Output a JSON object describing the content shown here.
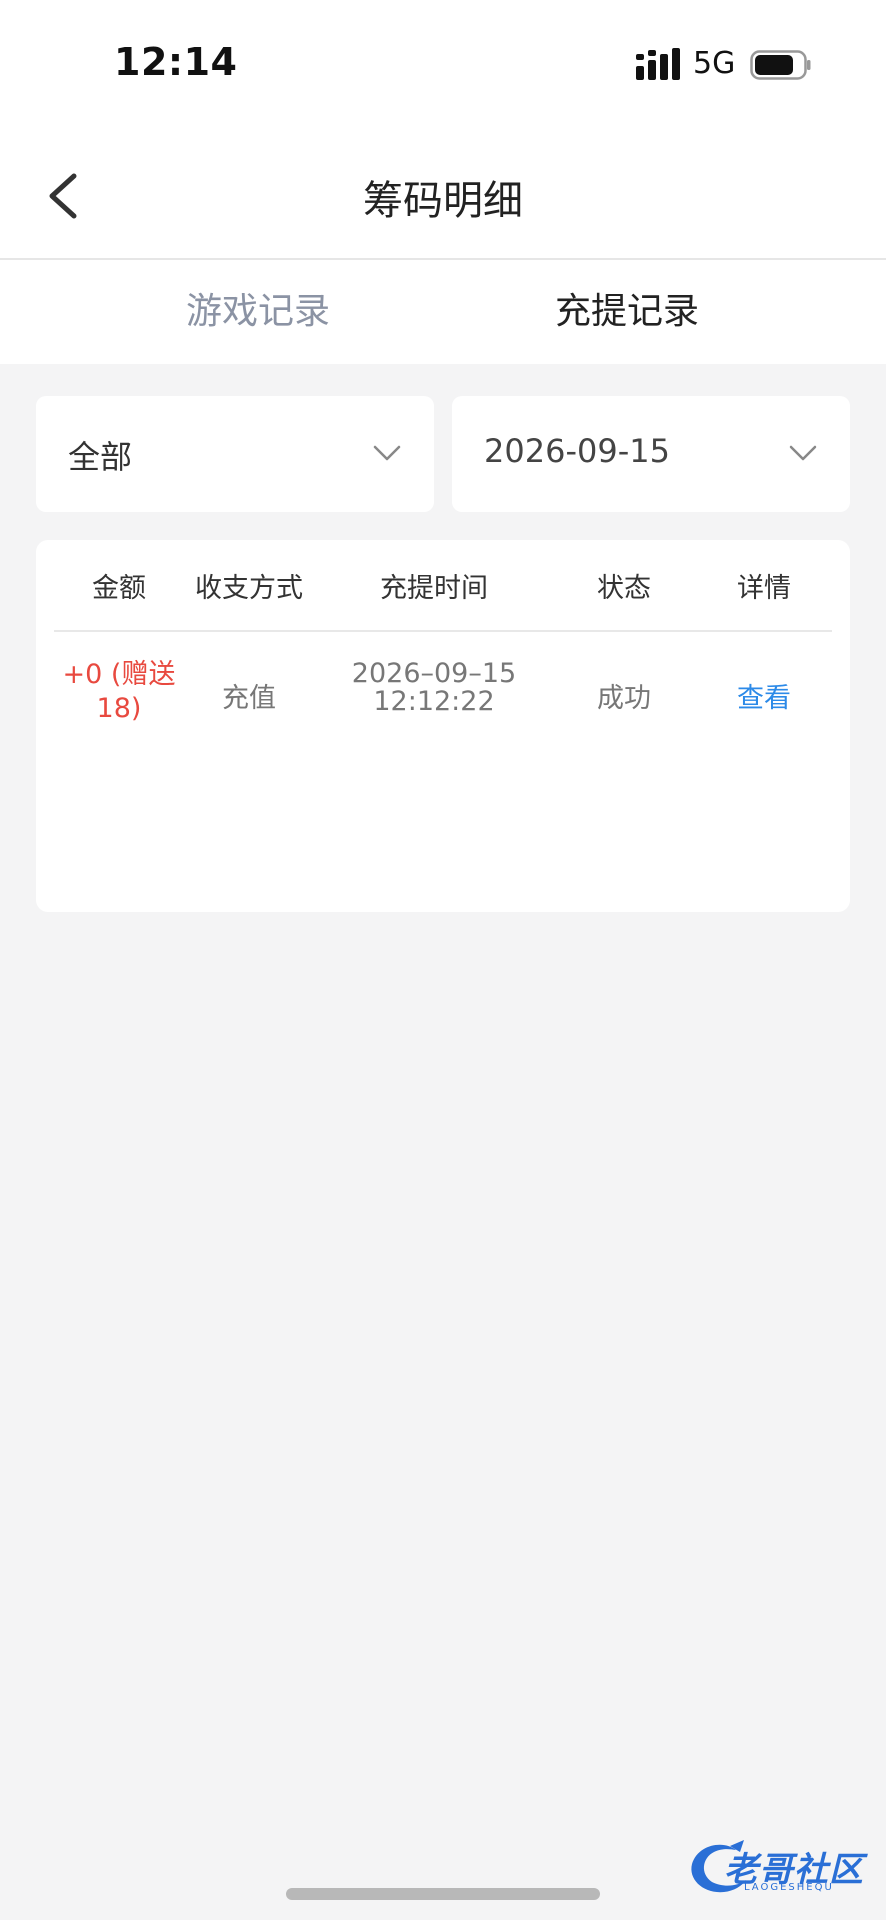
{
  "status_bar": {
    "time": "12:14",
    "network": "5G"
  },
  "header": {
    "title": "筹码明细"
  },
  "tabs": [
    {
      "label": "游戏记录",
      "active": false
    },
    {
      "label": "充提记录",
      "active": true
    }
  ],
  "filters": {
    "type": {
      "value": "全部"
    },
    "date": {
      "value": "2026-09-15"
    }
  },
  "table": {
    "columns": [
      "金额",
      "收支方式",
      "充提时间",
      "状态",
      "详情"
    ],
    "rows": [
      {
        "amount_line1": "+0 (赠送",
        "amount_line2": "18)",
        "method": "充值",
        "date": "2026–09–15",
        "time": "12:12:22",
        "status": "成功",
        "detail": "查看"
      }
    ]
  },
  "watermark": {
    "text": "老哥社区",
    "subtext": "LAOGESHEQU"
  },
  "colors": {
    "amount": "#e8493f",
    "link": "#2c8ae8",
    "tab_inactive": "#8b93a4",
    "background": "#f4f4f5"
  }
}
